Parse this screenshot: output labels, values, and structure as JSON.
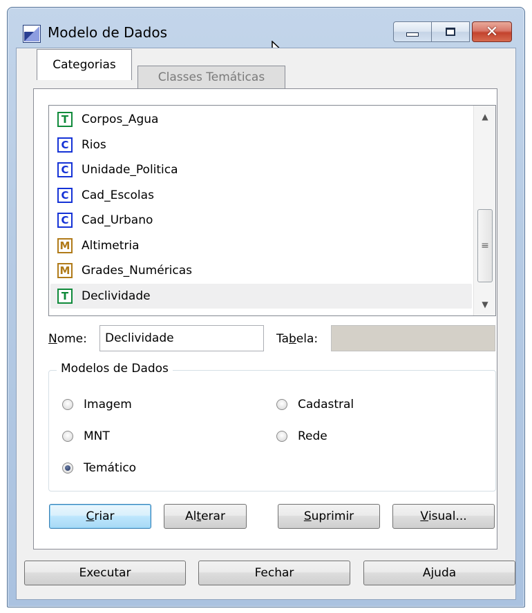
{
  "window": {
    "title": "Modelo de Dados",
    "close_glyph": "✕"
  },
  "tabs": [
    {
      "label": "Categorias",
      "active": true
    },
    {
      "label": "Classes Temáticas",
      "active": false
    }
  ],
  "categories": [
    {
      "type": "T",
      "label": "Corpos_Agua"
    },
    {
      "type": "C",
      "label": "Rios"
    },
    {
      "type": "C",
      "label": "Unidade_Politica"
    },
    {
      "type": "C",
      "label": "Cad_Escolas"
    },
    {
      "type": "C",
      "label": "Cad_Urbano"
    },
    {
      "type": "M",
      "label": "Altimetria"
    },
    {
      "type": "M",
      "label": "Grades_Numéricas"
    },
    {
      "type": "T",
      "label": "Declividade",
      "selected": true
    }
  ],
  "scrollbar": {
    "up_glyph": "▲",
    "down_glyph": "▼",
    "thumb_glyph": "≡"
  },
  "form": {
    "nome_label_u": "N",
    "nome_label_rest": "ome:",
    "nome_value": "Declividade",
    "tabela_label_pre": "Ta",
    "tabela_label_u": "b",
    "tabela_label_rest": "ela:",
    "tabela_value": ""
  },
  "group": {
    "title": "Modelos de Dados",
    "options": {
      "imagem": "Imagem",
      "cadastral": "Cadastral",
      "mnt": "MNT",
      "rede": "Rede",
      "tematico": "Temático"
    },
    "selected": "Temático"
  },
  "actions": {
    "criar_u": "C",
    "criar_rest": "riar",
    "alterar_pre": "Al",
    "alterar_u": "t",
    "alterar_rest": "erar",
    "suprimir_u": "S",
    "suprimir_rest": "uprimir",
    "visual_u": "V",
    "visual_rest": "isual..."
  },
  "footer": {
    "executar": "Executar",
    "fechar": "Fechar",
    "ajuda": "Ajuda"
  }
}
